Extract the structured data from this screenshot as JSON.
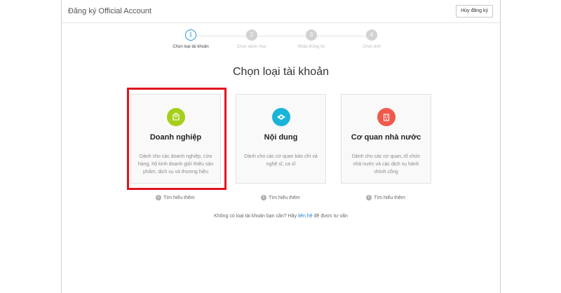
{
  "header": {
    "title": "Đăng ký Official Account",
    "cancel_label": "Hủy đăng ký"
  },
  "steps": [
    {
      "number": "1",
      "label": "Chọn loại tài khoản",
      "state": "active"
    },
    {
      "number": "2",
      "label": "Chọn danh mục",
      "state": "inactive"
    },
    {
      "number": "3",
      "label": "Nhập thông tin",
      "state": "inactive"
    },
    {
      "number": "4",
      "label": "Chọn ảnh",
      "state": "inactive"
    }
  ],
  "main": {
    "title": "Chọn loại tài khoản",
    "cards": [
      {
        "name": "Doanh nghiệp",
        "description": "Dành cho các doanh nghiệp, cửa hàng, hộ kinh doanh giới thiệu sản phẩm, dịch vụ và thương hiệu",
        "icon": "shopping-bag-icon",
        "icon_color": "#a6cf1c",
        "learn_more": "Tìm hiểu thêm"
      },
      {
        "name": "Nội dung",
        "description": "Dành cho các cơ quan báo chí và nghệ sĩ, ca sĩ",
        "icon": "content-icon",
        "icon_color": "#19b4d8",
        "learn_more": "Tìm hiểu thêm"
      },
      {
        "name": "Cơ quan nhà nước",
        "description": "Dành cho các cơ quan, tổ chức nhà nước và các dịch vụ hành chính công",
        "icon": "government-building-icon",
        "icon_color": "#ef5a4c",
        "learn_more": "Tìm hiểu thêm"
      }
    ],
    "selected_card": "Doanh nghiệp",
    "highlight_color": "#e0141e"
  },
  "footer": {
    "note_prefix": "Không có loại tài khoản bạn cần? Hãy",
    "link_text": "liên hệ",
    "note_suffix": "để được tư vấn"
  },
  "colors": {
    "accent": "#1b9ad6",
    "link": "#1b7fd6"
  }
}
